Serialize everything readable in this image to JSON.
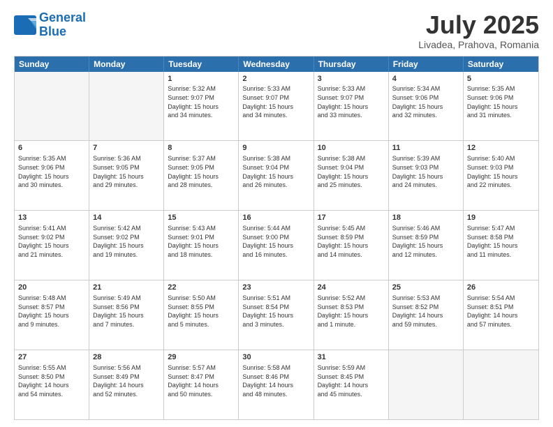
{
  "header": {
    "logo_line1": "General",
    "logo_line2": "Blue",
    "month": "July 2025",
    "location": "Livadea, Prahova, Romania"
  },
  "days_of_week": [
    "Sunday",
    "Monday",
    "Tuesday",
    "Wednesday",
    "Thursday",
    "Friday",
    "Saturday"
  ],
  "weeks": [
    [
      {
        "day": "",
        "content": ""
      },
      {
        "day": "",
        "content": ""
      },
      {
        "day": "1",
        "content": "Sunrise: 5:32 AM\nSunset: 9:07 PM\nDaylight: 15 hours\nand 34 minutes."
      },
      {
        "day": "2",
        "content": "Sunrise: 5:33 AM\nSunset: 9:07 PM\nDaylight: 15 hours\nand 34 minutes."
      },
      {
        "day": "3",
        "content": "Sunrise: 5:33 AM\nSunset: 9:07 PM\nDaylight: 15 hours\nand 33 minutes."
      },
      {
        "day": "4",
        "content": "Sunrise: 5:34 AM\nSunset: 9:06 PM\nDaylight: 15 hours\nand 32 minutes."
      },
      {
        "day": "5",
        "content": "Sunrise: 5:35 AM\nSunset: 9:06 PM\nDaylight: 15 hours\nand 31 minutes."
      }
    ],
    [
      {
        "day": "6",
        "content": "Sunrise: 5:35 AM\nSunset: 9:06 PM\nDaylight: 15 hours\nand 30 minutes."
      },
      {
        "day": "7",
        "content": "Sunrise: 5:36 AM\nSunset: 9:05 PM\nDaylight: 15 hours\nand 29 minutes."
      },
      {
        "day": "8",
        "content": "Sunrise: 5:37 AM\nSunset: 9:05 PM\nDaylight: 15 hours\nand 28 minutes."
      },
      {
        "day": "9",
        "content": "Sunrise: 5:38 AM\nSunset: 9:04 PM\nDaylight: 15 hours\nand 26 minutes."
      },
      {
        "day": "10",
        "content": "Sunrise: 5:38 AM\nSunset: 9:04 PM\nDaylight: 15 hours\nand 25 minutes."
      },
      {
        "day": "11",
        "content": "Sunrise: 5:39 AM\nSunset: 9:03 PM\nDaylight: 15 hours\nand 24 minutes."
      },
      {
        "day": "12",
        "content": "Sunrise: 5:40 AM\nSunset: 9:03 PM\nDaylight: 15 hours\nand 22 minutes."
      }
    ],
    [
      {
        "day": "13",
        "content": "Sunrise: 5:41 AM\nSunset: 9:02 PM\nDaylight: 15 hours\nand 21 minutes."
      },
      {
        "day": "14",
        "content": "Sunrise: 5:42 AM\nSunset: 9:02 PM\nDaylight: 15 hours\nand 19 minutes."
      },
      {
        "day": "15",
        "content": "Sunrise: 5:43 AM\nSunset: 9:01 PM\nDaylight: 15 hours\nand 18 minutes."
      },
      {
        "day": "16",
        "content": "Sunrise: 5:44 AM\nSunset: 9:00 PM\nDaylight: 15 hours\nand 16 minutes."
      },
      {
        "day": "17",
        "content": "Sunrise: 5:45 AM\nSunset: 8:59 PM\nDaylight: 15 hours\nand 14 minutes."
      },
      {
        "day": "18",
        "content": "Sunrise: 5:46 AM\nSunset: 8:59 PM\nDaylight: 15 hours\nand 12 minutes."
      },
      {
        "day": "19",
        "content": "Sunrise: 5:47 AM\nSunset: 8:58 PM\nDaylight: 15 hours\nand 11 minutes."
      }
    ],
    [
      {
        "day": "20",
        "content": "Sunrise: 5:48 AM\nSunset: 8:57 PM\nDaylight: 15 hours\nand 9 minutes."
      },
      {
        "day": "21",
        "content": "Sunrise: 5:49 AM\nSunset: 8:56 PM\nDaylight: 15 hours\nand 7 minutes."
      },
      {
        "day": "22",
        "content": "Sunrise: 5:50 AM\nSunset: 8:55 PM\nDaylight: 15 hours\nand 5 minutes."
      },
      {
        "day": "23",
        "content": "Sunrise: 5:51 AM\nSunset: 8:54 PM\nDaylight: 15 hours\nand 3 minutes."
      },
      {
        "day": "24",
        "content": "Sunrise: 5:52 AM\nSunset: 8:53 PM\nDaylight: 15 hours\nand 1 minute."
      },
      {
        "day": "25",
        "content": "Sunrise: 5:53 AM\nSunset: 8:52 PM\nDaylight: 14 hours\nand 59 minutes."
      },
      {
        "day": "26",
        "content": "Sunrise: 5:54 AM\nSunset: 8:51 PM\nDaylight: 14 hours\nand 57 minutes."
      }
    ],
    [
      {
        "day": "27",
        "content": "Sunrise: 5:55 AM\nSunset: 8:50 PM\nDaylight: 14 hours\nand 54 minutes."
      },
      {
        "day": "28",
        "content": "Sunrise: 5:56 AM\nSunset: 8:49 PM\nDaylight: 14 hours\nand 52 minutes."
      },
      {
        "day": "29",
        "content": "Sunrise: 5:57 AM\nSunset: 8:47 PM\nDaylight: 14 hours\nand 50 minutes."
      },
      {
        "day": "30",
        "content": "Sunrise: 5:58 AM\nSunset: 8:46 PM\nDaylight: 14 hours\nand 48 minutes."
      },
      {
        "day": "31",
        "content": "Sunrise: 5:59 AM\nSunset: 8:45 PM\nDaylight: 14 hours\nand 45 minutes."
      },
      {
        "day": "",
        "content": ""
      },
      {
        "day": "",
        "content": ""
      }
    ]
  ]
}
